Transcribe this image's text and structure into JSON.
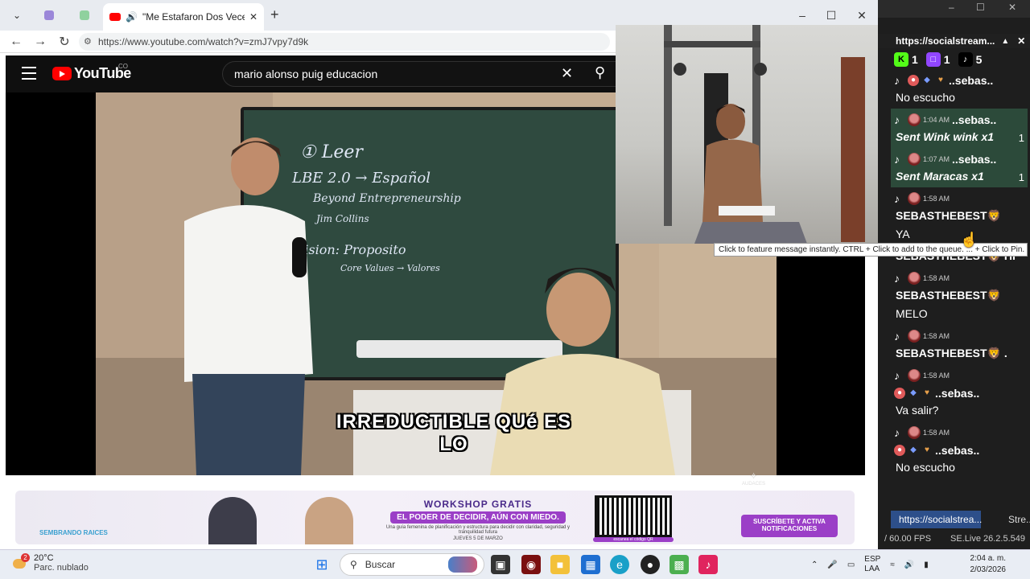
{
  "browser": {
    "tabs": [
      {
        "label": "",
        "icon": "shield-icon",
        "color": "#7b61c9"
      },
      {
        "label": "",
        "icon": "dollar-icon",
        "color": "#34a853"
      }
    ],
    "active_tab": {
      "title": "\"Me Estafaron Dos Veces y ho",
      "audio_icon": "speaker-icon"
    },
    "new_tab": "+",
    "url": "https://www.youtube.com/watch?v=zmJ7vpy7d9k"
  },
  "youtube": {
    "logo_text": "YouTube",
    "country": "CO",
    "search_value": "mario alonso puig educacion",
    "video": {
      "subtitle": "IRREDUCTIBLE QUé ES LO",
      "whiteboard_lines": [
        "① Leer",
        "LBE 2.0 → Español",
        "Beyond Entrepreneurship",
        "Jim Collins",
        "Vision: Proposito",
        "Core Values → Valores"
      ],
      "watermark": "AUDACES"
    },
    "ad": {
      "brand": "SEMBRANDO RAICES",
      "workshop": "WORKSHOP GRATIS",
      "headline": "EL PODER DE DECIDIR, AÚN CON MIEDO.",
      "subtext": "Una guía femenina de planificación y estructura para decidir con claridad, seguridad y tranquilidad futura",
      "date": "JUEVES 5 DE MARZO",
      "qr_caption": "escanea el código QR",
      "subscribe": "SUSCRÍBETE Y ACTIVA NOTIFICACIONES"
    }
  },
  "chat": {
    "url": "https://socialstream...",
    "counts": [
      {
        "icon": "kick-icon",
        "value": "1",
        "color": "#53fc18"
      },
      {
        "icon": "twitch-icon",
        "value": "1",
        "color": "#9146ff"
      },
      {
        "icon": "tiktok-icon",
        "value": "5",
        "color": "#000000"
      }
    ],
    "messages": [
      {
        "time": "",
        "user": "..sebas..",
        "text": "No escucho",
        "gift": false,
        "count": ""
      },
      {
        "time": "1:04 AM",
        "user": "..sebas..",
        "text": "Sent Wink wink x1",
        "gift": true,
        "count": "1"
      },
      {
        "time": "1:07 AM",
        "user": "..sebas..",
        "text": "Sent Maracas x1",
        "gift": true,
        "count": "1"
      },
      {
        "time": "1:58 AM",
        "user": "SEBASTHEBEST🦁",
        "text": "YA",
        "gift": false,
        "count": ""
      },
      {
        "time": "",
        "user": "SEBASTHEBEST🦁 HI",
        "text": "",
        "gift": false,
        "count": ""
      },
      {
        "time": "1:58 AM",
        "user": "SEBASTHEBEST🦁",
        "text": "MELO",
        "gift": false,
        "count": ""
      },
      {
        "time": "1:58 AM",
        "user": "SEBASTHEBEST🦁 .",
        "text": "",
        "gift": false,
        "count": ""
      },
      {
        "time": "1:58 AM",
        "user": "..sebas..",
        "text": "Va salir?",
        "gift": false,
        "count": ""
      },
      {
        "time": "1:58 AM",
        "user": "..sebas..",
        "text": "No escucho",
        "gift": false,
        "count": ""
      }
    ],
    "tooltip": "Click to feature message instantly. CTRL + Click to add to the queue. ... + Click to Pin.",
    "tab1": "https://socialstrea...",
    "tab2": "Stre...",
    "fps": "/ 60.00 FPS",
    "version": "SE.Live 26.2.5.549"
  },
  "taskbar": {
    "temperature": "20°C",
    "condition": "Parc. nublado",
    "weather_badge": "2",
    "search_placeholder": "Buscar",
    "language": "ESP",
    "language_sub": "LAA",
    "time": "2:04 a. m.",
    "date": "2/03/2026"
  }
}
